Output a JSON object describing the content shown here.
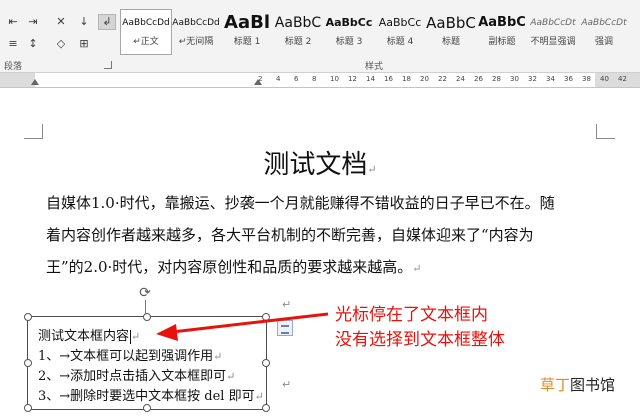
{
  "ribbon": {
    "paragraph_group_label": "段落",
    "styles_group_label": "样式",
    "styles": [
      {
        "preview": "AaBbCcDd",
        "name": "↵正文",
        "active": true
      },
      {
        "preview": "AaBbCcDd",
        "name": "↵无间隔",
        "active": false
      },
      {
        "preview": "AaBl",
        "name": "标题 1",
        "active": false
      },
      {
        "preview": "AaBbC",
        "name": "标题 2",
        "active": false
      },
      {
        "preview": "AaBbCc",
        "name": "标题 3",
        "active": false
      },
      {
        "preview": "AaBbCc",
        "name": "标题 4",
        "active": false
      },
      {
        "preview": "AaBbC",
        "name": "标题",
        "active": false
      },
      {
        "preview": "AaBbC",
        "name": "副标题",
        "active": false
      },
      {
        "preview": "AaBbCcDt",
        "name": "不明显强调",
        "active": false
      },
      {
        "preview": "AaBbCcDt",
        "name": "强调",
        "active": false
      }
    ]
  },
  "ruler": {
    "numbers": [
      "2",
      "4",
      "6",
      "8",
      "10",
      "12",
      "14",
      "16",
      "18",
      "20",
      "22",
      "24",
      "26",
      "28",
      "30",
      "32",
      "34",
      "36",
      "38",
      "40",
      "42"
    ]
  },
  "document": {
    "title": "测试文档",
    "paragraph_lines": [
      "自媒体1.0·时代，靠搬运、抄袭一个月就能赚得不错收益的日子早已不在。随",
      "着内容创作者越来越多，各大平台机制的不断完善，自媒体迎来了“内容为",
      "王”的2.0·时代，对内容原创性和品质的要求越来越高。"
    ]
  },
  "textbox": {
    "lines": [
      "测试文本框内容",
      "1、→文本框可以起到强调作用",
      "2、→添加时点击插入文本框即可",
      "3、→删除时要选中文本框按 del 即可"
    ]
  },
  "annotation": {
    "line1": "光标停在了文本框内",
    "line2": "没有选择到文本框整体",
    "color": "#e8120c"
  },
  "watermark": {
    "orange_part": "草丁",
    "dark_part": "图书馆"
  }
}
